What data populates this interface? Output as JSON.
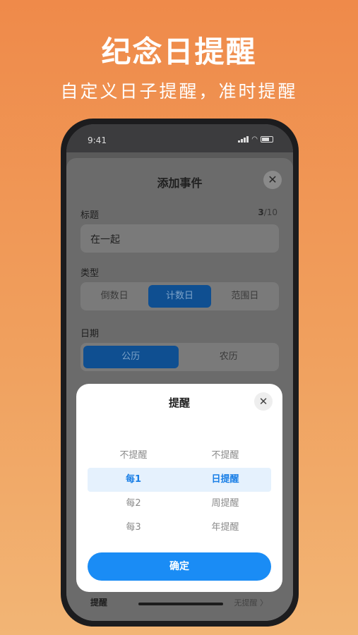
{
  "promo": {
    "headline": "纪念日提醒",
    "subline": "自定义日子提醒，准时提醒"
  },
  "status_bar": {
    "time": "9:41"
  },
  "add_event": {
    "title": "添加事件",
    "title_label": "标题",
    "title_count": "3",
    "title_max": "/10",
    "title_value": "在一起",
    "type_label": "类型",
    "type_options": [
      "倒数日",
      "计数日",
      "范围日"
    ],
    "type_selected": "计数日",
    "date_label": "日期",
    "date_options": [
      "公历",
      "农历"
    ],
    "date_selected": "公历",
    "reminder_label": "提醒",
    "reminder_value": "无提醒 〉"
  },
  "reminder_modal": {
    "title": "提醒",
    "rows": [
      {
        "left": "不提醒",
        "right": "不提醒",
        "selected": false
      },
      {
        "left": "每1",
        "right": "日提醒",
        "selected": true
      },
      {
        "left": "每2",
        "right": "周提醒",
        "selected": false
      },
      {
        "left": "每3",
        "right": "年提醒",
        "selected": false
      }
    ],
    "confirm_label": "确定"
  },
  "colors": {
    "accent": "#1a8cf5",
    "selected_segment": "#0f4f91",
    "background_top": "#ef8a4a",
    "background_bottom": "#f2b575"
  }
}
